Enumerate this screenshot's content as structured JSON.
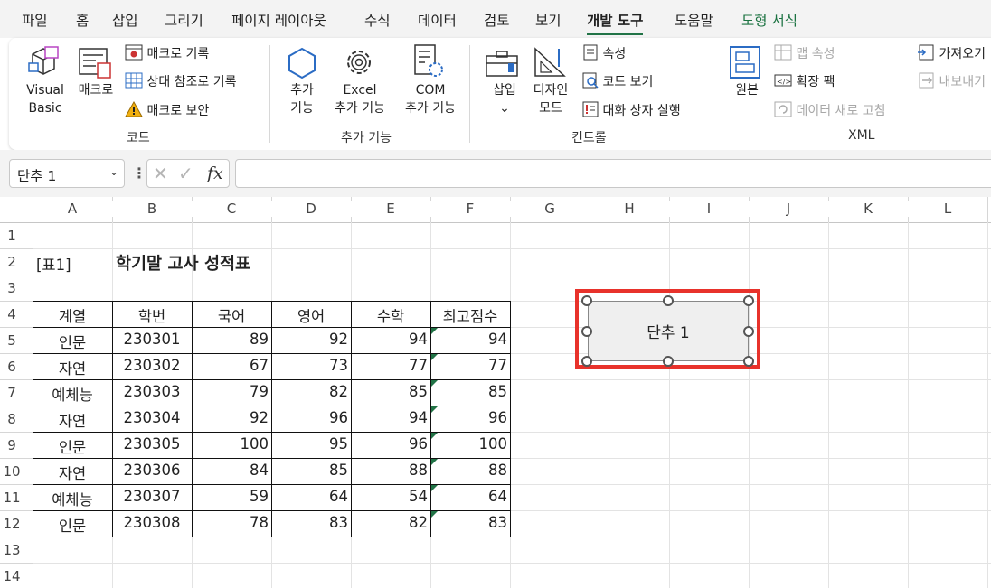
{
  "menu": {
    "tabs": [
      "파일",
      "홈",
      "삽입",
      "그리기",
      "페이지 레이아웃",
      "수식",
      "데이터",
      "검토",
      "보기",
      "개발 도구",
      "도움말",
      "도형 서식"
    ],
    "active": "개발 도구"
  },
  "ribbon": {
    "code": {
      "visual_basic": [
        "Visual",
        "Basic"
      ],
      "macros": "매크로",
      "record_macro": "매크로 기록",
      "relative_ref": "상대 참조로 기록",
      "macro_security": "매크로 보안",
      "label": "코드"
    },
    "addins": {
      "addins": [
        "추가",
        "기능"
      ],
      "excel_addins": [
        "Excel",
        "추가 기능"
      ],
      "com_addins": [
        "COM",
        "추가 기능"
      ],
      "label": "추가 기능"
    },
    "controls": {
      "insert": "삽입",
      "design_mode": [
        "디자인",
        "모드"
      ],
      "properties": "속성",
      "view_code": "코드 보기",
      "run_dialog": "대화 상자 실행",
      "label": "컨트롤"
    },
    "xml": {
      "source": "원본",
      "map_properties": "맵 속성",
      "expansion_packs": "확장 팩",
      "refresh_data": "데이터 새로 고침",
      "import": "가져오기",
      "export": "내보내기",
      "label": "XML"
    }
  },
  "formula_bar": {
    "name_box": "단추 1",
    "fx": "fx",
    "formula": ""
  },
  "sheet": {
    "columns": [
      "A",
      "B",
      "C",
      "D",
      "E",
      "F",
      "G",
      "H",
      "I",
      "J",
      "K",
      "L"
    ],
    "rows": [
      "1",
      "2",
      "3",
      "4",
      "5",
      "6",
      "7",
      "8",
      "9",
      "10",
      "11",
      "12",
      "13",
      "14"
    ],
    "table_label": "[표1]",
    "title": "학기말 고사 성적표",
    "headers": [
      "계열",
      "학번",
      "국어",
      "영어",
      "수학",
      "최고점수"
    ],
    "data": [
      [
        "인문",
        "230301",
        "89",
        "92",
        "94",
        "94"
      ],
      [
        "자연",
        "230302",
        "67",
        "73",
        "77",
        "77"
      ],
      [
        "예체능",
        "230303",
        "79",
        "82",
        "85",
        "85"
      ],
      [
        "자연",
        "230304",
        "92",
        "96",
        "94",
        "96"
      ],
      [
        "인문",
        "230305",
        "100",
        "95",
        "96",
        "100"
      ],
      [
        "자연",
        "230306",
        "84",
        "85",
        "88",
        "88"
      ],
      [
        "예체능",
        "230307",
        "59",
        "64",
        "54",
        "64"
      ],
      [
        "인문",
        "230308",
        "78",
        "83",
        "82",
        "83"
      ]
    ]
  },
  "shape": {
    "label": "단추 1",
    "selection_color": "#e8322b"
  },
  "colors": {
    "accent": "#217346",
    "tab_green": "#1c7342"
  }
}
